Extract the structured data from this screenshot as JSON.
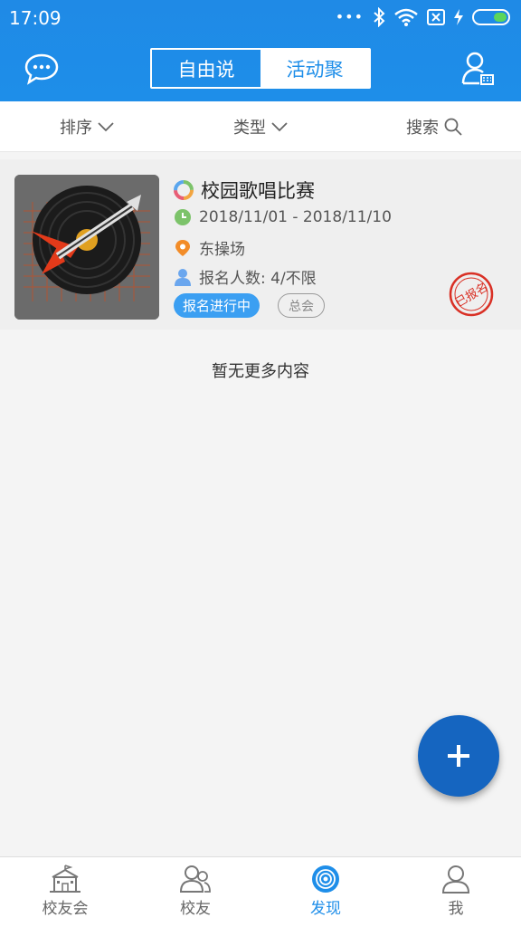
{
  "status_bar": {
    "time": "17:09",
    "dots": "•••",
    "icons": [
      "bluetooth-icon",
      "wifi-icon",
      "sim-icon",
      "charging-icon",
      "battery-icon"
    ]
  },
  "header": {
    "segments": [
      {
        "label": "自由说",
        "active": false
      },
      {
        "label": "活动聚",
        "active": true
      }
    ],
    "left_icon": "chat-bubble-icon",
    "right_icon": "user-card-icon"
  },
  "filters": [
    {
      "label": "排序",
      "icon": "chevron-down-icon"
    },
    {
      "label": "类型",
      "icon": "chevron-down-icon"
    },
    {
      "label": "搜索",
      "icon": "search-icon"
    }
  ],
  "event": {
    "title": "校园歌唱比赛",
    "date_range": "2018/11/01 - 2018/11/10",
    "location": "东操场",
    "participants": "报名人数: 4/不限",
    "status_tag": "报名进行中",
    "org_tag": "总会",
    "stamp_text": "已报名"
  },
  "list_end_text": "暂无更多内容",
  "fab_icon": "plus-icon",
  "tabs": [
    {
      "label": "校友会",
      "icon": "school-building-icon",
      "active": false
    },
    {
      "label": "校友",
      "icon": "people-icon",
      "active": false
    },
    {
      "label": "发现",
      "icon": "discover-icon",
      "active": true
    },
    {
      "label": "我",
      "icon": "person-icon",
      "active": false
    }
  ],
  "colors": {
    "primary": "#1e8ee9",
    "fab": "#1565c0",
    "status_tag": "#3b9ff2",
    "stamp": "#d93025"
  }
}
